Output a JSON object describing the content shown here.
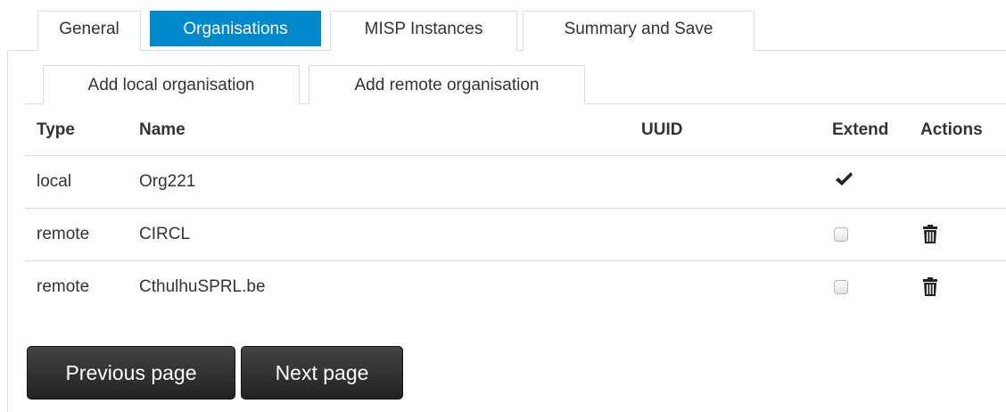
{
  "tabs": [
    {
      "label": "General",
      "active": false
    },
    {
      "label": "Organisations",
      "active": true
    },
    {
      "label": "MISP Instances",
      "active": false
    },
    {
      "label": "Summary and Save",
      "active": false
    }
  ],
  "subtabs": [
    {
      "label": "Add local organisation"
    },
    {
      "label": "Add remote organisation"
    }
  ],
  "table": {
    "headers": {
      "type": "Type",
      "name": "Name",
      "uuid": "UUID",
      "extend": "Extend",
      "actions": "Actions"
    },
    "rows": [
      {
        "type": "local",
        "name": "Org221",
        "uuid": "",
        "extend": "checkmark-icon",
        "actions": ""
      },
      {
        "type": "remote",
        "name": "CIRCL",
        "uuid": "",
        "extend": "checkbox",
        "actions": "trash-icon"
      },
      {
        "type": "remote",
        "name": "CthulhuSPRL.be",
        "uuid": "",
        "extend": "checkbox",
        "actions": "trash-icon"
      }
    ]
  },
  "buttons": {
    "previous": "Previous page",
    "next": "Next page"
  },
  "colors": {
    "active_tab": "#0088cc",
    "button": "#222222"
  }
}
